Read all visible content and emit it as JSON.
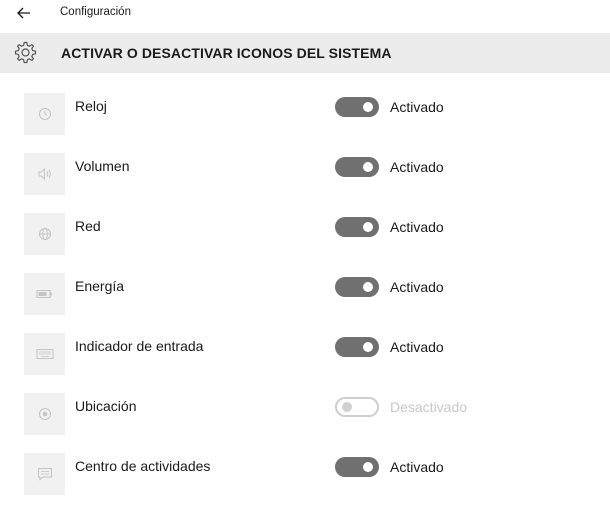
{
  "window": {
    "title": "Configuración",
    "back_icon": "back-arrow-icon"
  },
  "header": {
    "icon": "gear-icon",
    "title": "ACTIVAR O DESACTIVAR ICONOS DEL SISTEMA"
  },
  "colors": {
    "toggle_on": "#707070",
    "toggle_off_border": "#cfcfcf",
    "header_bg": "#ececec",
    "tile_bg": "#f1f1f1"
  },
  "items": [
    {
      "label": "Reloj",
      "icon": "clock-icon",
      "state": "Activado",
      "on": true
    },
    {
      "label": "Volumen",
      "icon": "volume-icon",
      "state": "Activado",
      "on": true
    },
    {
      "label": "Red",
      "icon": "network-icon",
      "state": "Activado",
      "on": true
    },
    {
      "label": "Energía",
      "icon": "battery-icon",
      "state": "Activado",
      "on": true
    },
    {
      "label": "Indicador de entrada",
      "icon": "keyboard-icon",
      "state": "Activado",
      "on": true
    },
    {
      "label": "Ubicación",
      "icon": "location-icon",
      "state": "Desactivado",
      "on": false
    },
    {
      "label": "Centro de actividades",
      "icon": "action-center-icon",
      "state": "Activado",
      "on": true
    }
  ]
}
